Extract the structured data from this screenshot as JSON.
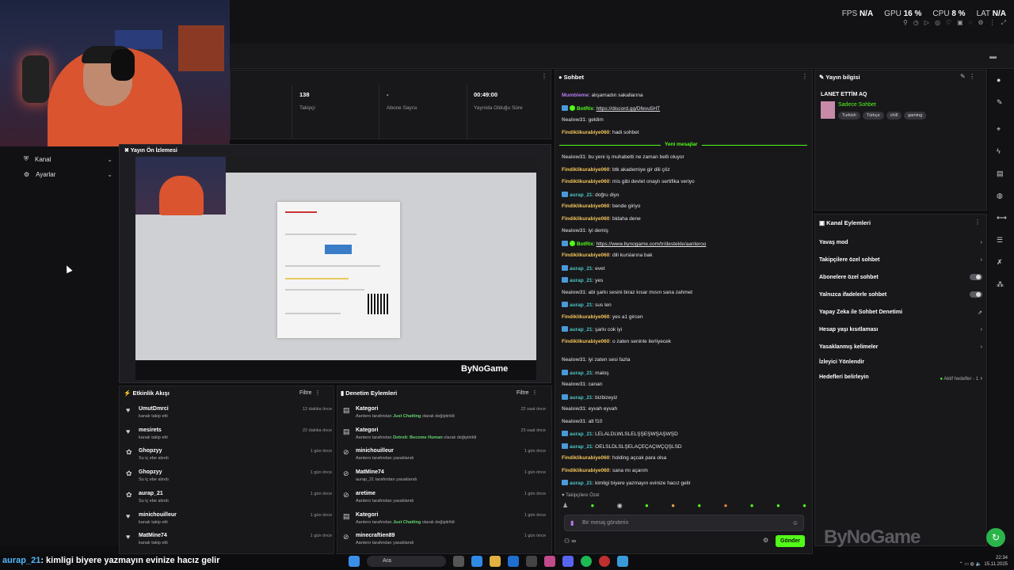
{
  "top": {
    "fps_label": "FPS",
    "fps_value": "N/A",
    "gpu_label": "GPU",
    "gpu_value": "16 %",
    "cpu_label": "CPU",
    "cpu_value": "8 %",
    "lat_label": "LAT",
    "lat_value": "N/A"
  },
  "nav": {
    "kanal": "Kanal",
    "ayarlar": "Ayarlar"
  },
  "stats": [
    {
      "value": "138",
      "label": "Takipçi"
    },
    {
      "value": "-",
      "label": "Abone Sayısı"
    },
    {
      "value": "00:49:00",
      "label": "Yayında Olduğu Süre"
    }
  ],
  "preview": {
    "title": "Yayın Ön İzlemesi",
    "logo": "ByNoGame"
  },
  "activity": {
    "title": "Etkinlik Akışı",
    "filter": "Filtre",
    "items": [
      {
        "icon": "heart-icon",
        "glyph": "♥",
        "name": "UmutDmrci",
        "desc": "kanalı takip etti",
        "time": "12 dakika önce"
      },
      {
        "icon": "heart-icon",
        "glyph": "♥",
        "name": "mesirets",
        "desc": "kanalı takip etti",
        "time": "22 dakika önce"
      },
      {
        "icon": "gift-icon",
        "glyph": "✿",
        "name": "Ghopzyy",
        "desc": "Su iç ebe alındı",
        "time": "1 gün önce"
      },
      {
        "icon": "gift-icon",
        "glyph": "✿",
        "name": "Ghopzyy",
        "desc": "Su iç ebe alındı",
        "time": "1 gün önce"
      },
      {
        "icon": "gift-icon",
        "glyph": "✿",
        "name": "aurap_21",
        "desc": "Su iç ebe alındı",
        "time": "1 gün önce"
      },
      {
        "icon": "heart-icon",
        "glyph": "♥",
        "name": "minichouilleur",
        "desc": "kanalı takip etti",
        "time": "1 gün önce"
      },
      {
        "icon": "heart-icon",
        "glyph": "♥",
        "name": "MatMine74",
        "desc": "kanalı takip etti",
        "time": "1 gün önce"
      }
    ]
  },
  "moderation": {
    "title": "Denetim Eylemleri",
    "filter": "Filtre",
    "items": [
      {
        "icon": "category-icon",
        "glyph": "▤",
        "name": "Kategori",
        "pre": "Aantero tarafından ",
        "hl": "Just Chatting",
        "post": " olarak değiştirildi",
        "time": "22 saat önce"
      },
      {
        "icon": "category-icon",
        "glyph": "▤",
        "name": "Kategori",
        "pre": "Aantero tarafından ",
        "hl": "Detroit: Become Human",
        "post": " olarak değiştirildi",
        "time": "23 saat önce"
      },
      {
        "icon": "ban-icon",
        "glyph": "⊘",
        "name": "minichouilleur",
        "pre": "Aantero tarafından yasaklandı",
        "hl": "",
        "post": "",
        "time": "1 gün önce"
      },
      {
        "icon": "ban-icon",
        "glyph": "⊘",
        "name": "MatMine74",
        "pre": "aurap_21 tarafından yasaklandı",
        "hl": "",
        "post": "",
        "time": "1 gün önce"
      },
      {
        "icon": "ban-icon",
        "glyph": "⊘",
        "name": "aretime",
        "pre": "Aantero tarafından yasaklandı",
        "hl": "",
        "post": "",
        "time": "1 gün önce"
      },
      {
        "icon": "category-icon",
        "glyph": "▤",
        "name": "Kategori",
        "pre": "Aantero tarafından ",
        "hl": "Just Chatting",
        "post": " olarak değiştirildi",
        "time": "1 gün önce"
      },
      {
        "icon": "ban-icon",
        "glyph": "⊘",
        "name": "minecraftien89",
        "pre": "Aantero tarafından yasaklandı",
        "hl": "",
        "post": "",
        "time": "1 gün önce"
      }
    ]
  },
  "chat": {
    "title": "Sohbet",
    "new_messages": "Yeni mesajlar",
    "input_placeholder": "Bir mesaj gönderin",
    "send": "Gönder",
    "followers_label": "Takipçilere Özel",
    "messages": [
      {
        "user": "Mumbleme",
        "color": "#b77cf0",
        "text": ": alışamadın sakallarına",
        "badge": false,
        "link": false
      },
      {
        "user": "BotRix",
        "color": "#53fc18",
        "text": "https://discord.gg/Dfevu5HT",
        "badge": true,
        "link": true
      },
      {
        "user": "Nealow31",
        "color": "#b4b4ba",
        "text": ": geldim",
        "badge": false,
        "link": false
      },
      {
        "user": "Findiklikurabiye060",
        "color": "#f5c65a",
        "text": ": hadi sohbet",
        "badge": false,
        "link": false
      },
      {
        "user": "Nealow31",
        "color": "#b4b4ba",
        "text": ": bu yeni iş muhabetti ne zaman belli oluyor",
        "badge": false,
        "link": false
      },
      {
        "user": "Findiklikurabiye060",
        "color": "#f5c65a",
        "text": ": btk akademiye gir dili çöz",
        "badge": false,
        "link": false
      },
      {
        "user": "Findiklikurabiye060",
        "color": "#f5c65a",
        "text": ": mis gibi devlet onaylı sertifika veriyo",
        "badge": false,
        "link": false
      },
      {
        "user": "aurap_21",
        "color": "#4fc3c3",
        "text": ": doğru diyo",
        "badge": true,
        "link": false
      },
      {
        "user": "Findiklikurabiye060",
        "color": "#f5c65a",
        "text": ": bende giriyo",
        "badge": false,
        "link": false
      },
      {
        "user": "Findiklikurabiye060",
        "color": "#f5c65a",
        "text": ": bidaha dene",
        "badge": false,
        "link": false
      },
      {
        "user": "Nealow31",
        "color": "#b4b4ba",
        "text": ": iyi demiş",
        "badge": false,
        "link": false
      },
      {
        "user": "BotRix",
        "color": "#53fc18",
        "text": "https://www.bynogame.com/tr/destekle/aanteroo",
        "badge": true,
        "link": true
      },
      {
        "user": "Findiklikurabiye060",
        "color": "#f5c65a",
        "text": ": dili kurslarına bak",
        "badge": false,
        "link": false
      },
      {
        "user": "aurap_21",
        "color": "#4fc3c3",
        "text": ": evet",
        "badge": true,
        "link": false
      },
      {
        "user": "aurap_21",
        "color": "#4fc3c3",
        "text": ": yes",
        "badge": true,
        "link": false
      },
      {
        "user": "Nealow31",
        "color": "#b4b4ba",
        "text": ": abi şarkı sesini biraz kısar mısın sana zahmet",
        "badge": false,
        "link": false
      },
      {
        "user": "aurap_21",
        "color": "#4fc3c3",
        "text": ": sus len",
        "badge": true,
        "link": false
      },
      {
        "user": "Findiklikurabiye060",
        "color": "#f5c65a",
        "text": ": yes a1 gircen",
        "badge": false,
        "link": false
      },
      {
        "user": "aurap_21",
        "color": "#4fc3c3",
        "text": ": şarkı cok iyi",
        "badge": true,
        "link": false
      },
      {
        "user": "Findiklikurabiye060",
        "color": "#f5c65a",
        "text": ": o zaten seninle ilerliyecek",
        "badge": false,
        "link": false
      },
      {
        "user": "Nealow31",
        "color": "#b4b4ba",
        "text": ": iyi zaten sesi fazla",
        "badge": false,
        "link": false
      },
      {
        "user": "aurap_21",
        "color": "#4fc3c3",
        "text": ": maloş",
        "badge": true,
        "link": false
      },
      {
        "user": "Nealow31",
        "color": "#b4b4ba",
        "text": ": canarı",
        "badge": false,
        "link": false
      },
      {
        "user": "aurap_21",
        "color": "#4fc3c3",
        "text": ": bizbizeyiz",
        "badge": true,
        "link": false
      },
      {
        "user": "Nealow31",
        "color": "#b4b4ba",
        "text": ": eyvah eyvah",
        "badge": false,
        "link": false
      },
      {
        "user": "Nealow31",
        "color": "#b4b4ba",
        "text": ": alt f10",
        "badge": false,
        "link": false
      },
      {
        "user": "aurap_21",
        "color": "#4fc3c3",
        "text": ": LELALDLWLSLELŞŞEŞWŞAŞWŞD",
        "badge": true,
        "link": false
      },
      {
        "user": "aurap_21",
        "color": "#4fc3c3",
        "text": ": OELSLDLSLŞELAÇEÇAÇWÇQŞLSD",
        "badge": true,
        "link": false
      },
      {
        "user": "Findiklikurabiye060",
        "color": "#f5c65a",
        "text": ": holding açcak para olsa",
        "badge": false,
        "link": false
      },
      {
        "user": "Findiklikurabiye060",
        "color": "#f5c65a",
        "text": ": sana mı açarım",
        "badge": false,
        "link": false
      },
      {
        "user": "aurap_21",
        "color": "#4fc3c3",
        "text": ": kimligi biyere yazmayın evinize hacız gelir",
        "badge": true,
        "link": false
      }
    ]
  },
  "info": {
    "title": "Yayın bilgisi",
    "stream_title": "LANET ETTİM AQ",
    "category": "Sadece Sohbet",
    "tags": [
      "Turkish",
      "Türkçe",
      "chill",
      "gaming"
    ]
  },
  "actions": {
    "title": "Kanal Eylemleri",
    "items": [
      {
        "label": "Yavaş mod",
        "kind": "arrow"
      },
      {
        "label": "Takipçilere özel sohbet",
        "kind": "arrow"
      },
      {
        "label": "Abonelere özel sohbet",
        "kind": "toggle"
      },
      {
        "label": "Yalnızca ifadelerle sohbet",
        "kind": "toggle"
      },
      {
        "label": "Yapay Zeka ile Sohbet Denetimi",
        "kind": "ext"
      },
      {
        "label": "Hesap yaşı kısıtlaması",
        "kind": "arrow"
      },
      {
        "label": "Yasaklanmış kelimeler",
        "kind": "arrow"
      },
      {
        "label": "İzleyici Yönlendir",
        "kind": "none"
      },
      {
        "label": "Hedefleri belirleyin",
        "kind": "goal",
        "extra": "Aktif hedefler - 1"
      }
    ]
  },
  "overlay": {
    "user": "aurap_21",
    "text": ": kimligi biyere yazmayın evinize hacız gelir"
  },
  "taskbar": {
    "search": "Ara",
    "time": "22:34",
    "date": "15.11.2025"
  },
  "logo": "ByNoGame",
  "colors": {
    "accent": "#53fc18",
    "panel": "#18181b",
    "background": "#0e0e10"
  }
}
